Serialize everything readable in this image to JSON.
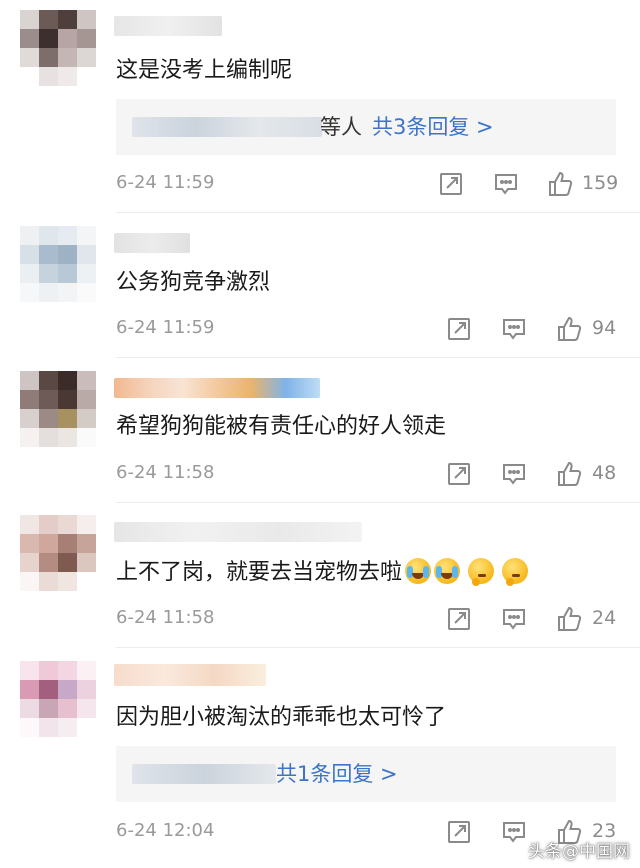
{
  "comments": [
    {
      "text": "这是没考上编制呢",
      "reply": {
        "suffix": "等人",
        "link": "共3条回复 >"
      },
      "time": "6-24 11:59",
      "likes": "159"
    },
    {
      "text": "公务狗竞争激烈",
      "time": "6-24 11:59",
      "likes": "94"
    },
    {
      "text": "希望狗狗能被有责任心的好人领走",
      "time": "6-24 11:58",
      "likes": "48"
    },
    {
      "text": "上不了岗，就要去当宠物去啦",
      "time": "6-24 11:58",
      "likes": "24"
    },
    {
      "text": "因为胆小被淘汰的乖乖也太可怜了",
      "reply": {
        "link": "共1条回复 >"
      },
      "time": "6-24 12:04",
      "likes": "23"
    }
  ],
  "emojis": [
    "crying-laughing-emoji",
    "crying-laughing-emoji",
    "thinking-emoji",
    "thinking-emoji"
  ],
  "watermark": "头条@中国网",
  "colors": {
    "link": "#3d74c7",
    "meta": "#9a9a9a",
    "reply_bg": "#f5f5f5"
  },
  "icons": [
    "share-icon",
    "comment-icon",
    "like-icon"
  ]
}
